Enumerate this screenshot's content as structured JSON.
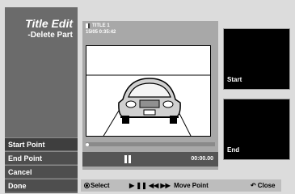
{
  "title": {
    "main": "Title Edit",
    "sub": "-Delete Part"
  },
  "menu": [
    {
      "label": "Start Point",
      "selected": true
    },
    {
      "label": "End Point"
    },
    {
      "label": "Cancel"
    },
    {
      "label": "Done"
    }
  ],
  "player": {
    "title": "TITLE 1",
    "datetime": "15/05   0:35:42",
    "timecode": "00:00.00",
    "progress": 0
  },
  "thumbs": {
    "start": "Start",
    "end": "End"
  },
  "help": {
    "select": "Select",
    "move_symbols": "▶ ❚❚ ◀◀ ▶▶",
    "move": "Move Point",
    "close_symbol": "↶",
    "close": "Close"
  },
  "colors": {
    "panel": "#6b6b6b",
    "menu": "#4e4e4e",
    "player": "#a8a8a8",
    "bar": "#bdbdbd"
  }
}
